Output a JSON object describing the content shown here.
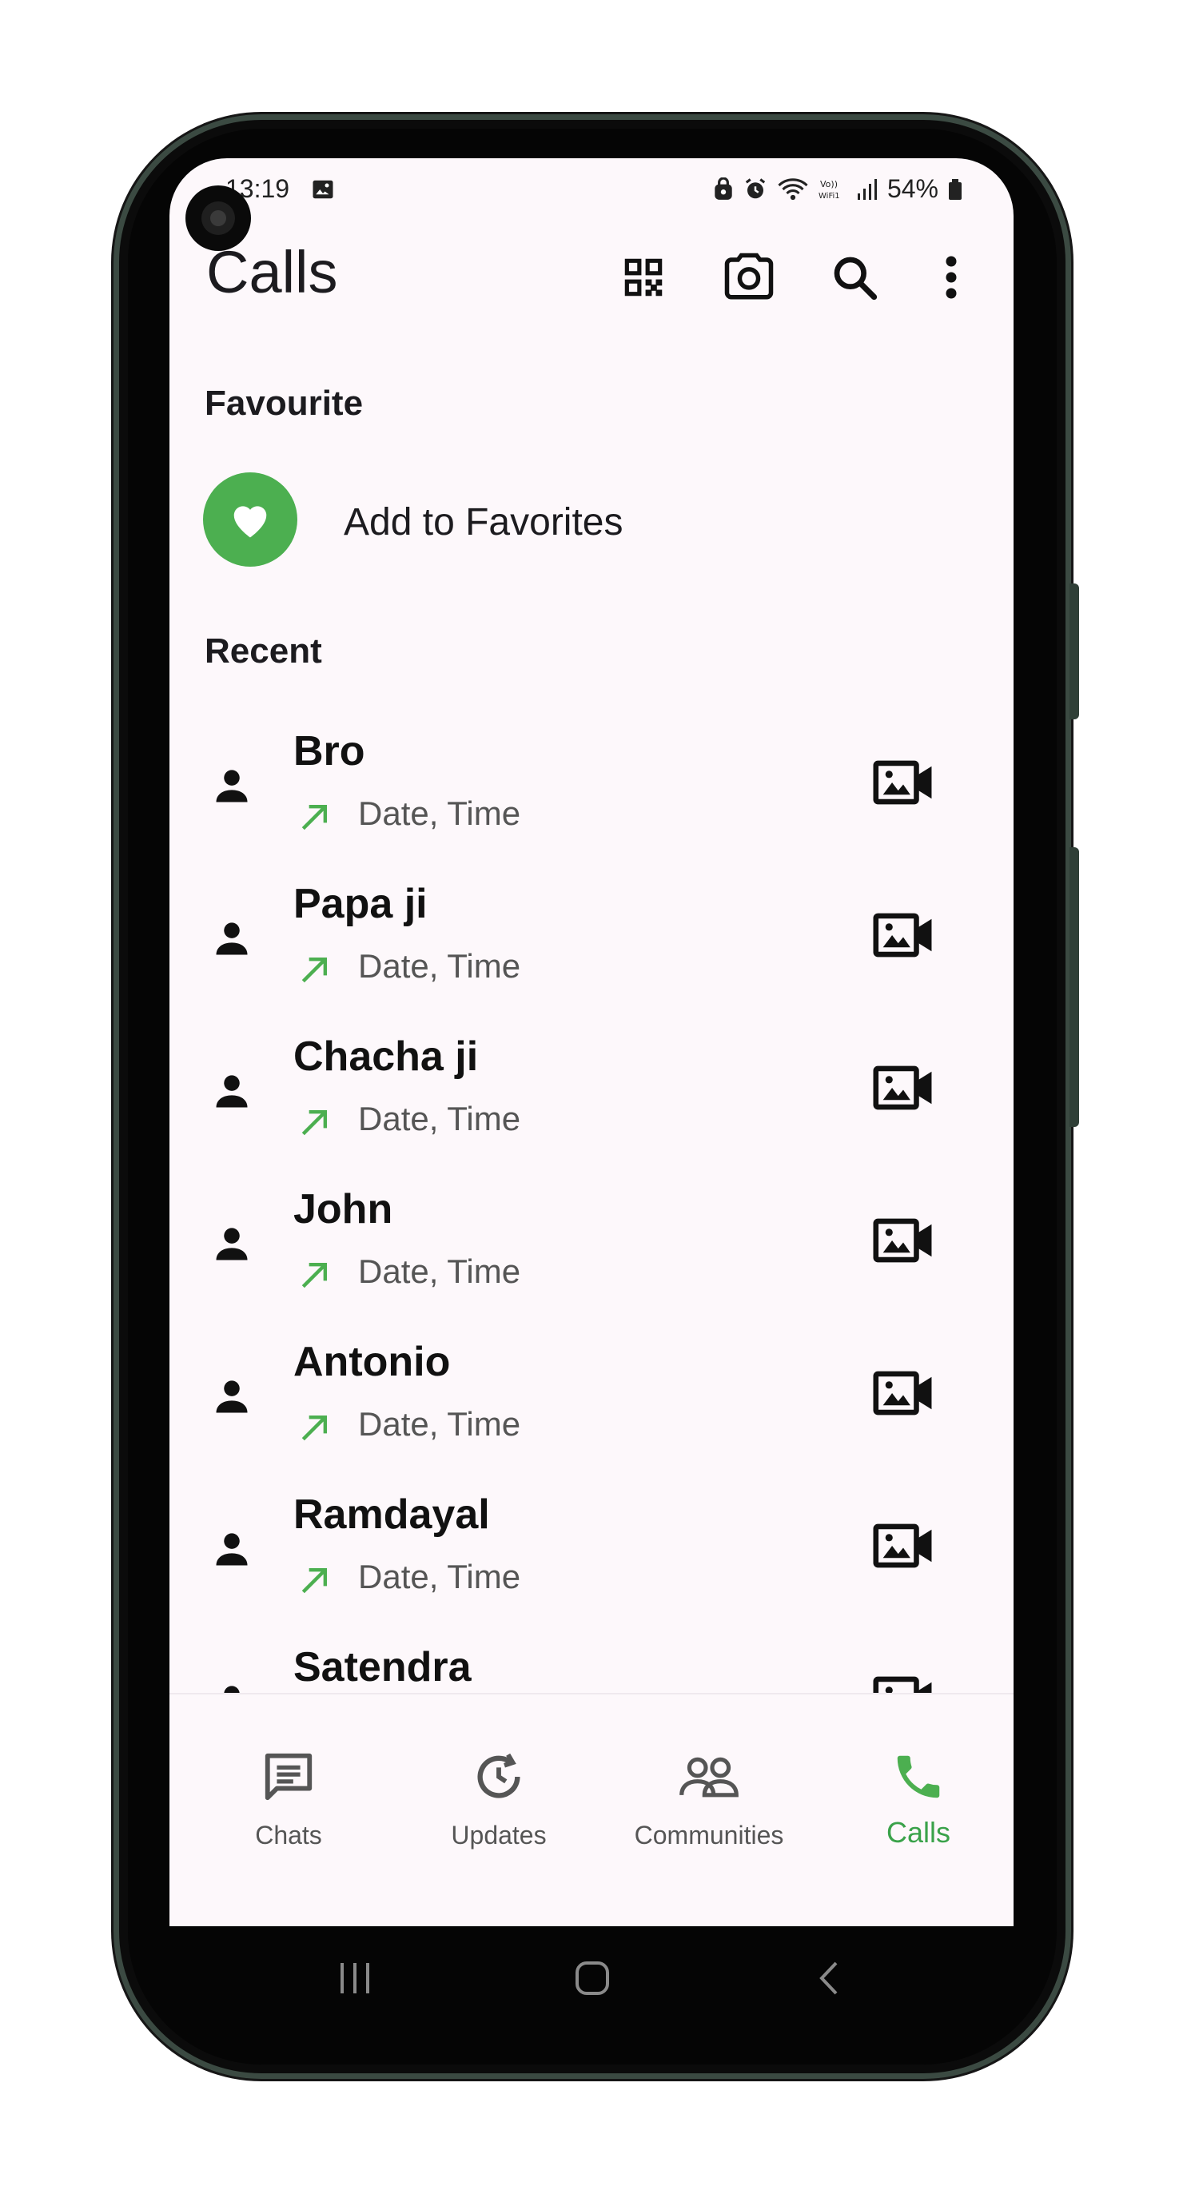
{
  "status_bar": {
    "time": "13:19",
    "battery": "54%"
  },
  "header": {
    "title": "Calls"
  },
  "favourite": {
    "section_title": "Favourite",
    "add_label": "Add to Favorites"
  },
  "recent": {
    "section_title": "Recent",
    "calls": [
      {
        "name": "Bro",
        "detail": "Date, Time"
      },
      {
        "name": "Papa ji",
        "detail": "Date, Time"
      },
      {
        "name": "Chacha ji",
        "detail": "Date, Time"
      },
      {
        "name": "John",
        "detail": "Date, Time"
      },
      {
        "name": "Antonio",
        "detail": "Date, Time"
      },
      {
        "name": "Ramdayal",
        "detail": "Date, Time"
      },
      {
        "name": "Satendra",
        "detail": ""
      }
    ]
  },
  "bottom_nav": {
    "items": [
      {
        "label": "Chats",
        "icon": "chat-icon"
      },
      {
        "label": "Updates",
        "icon": "updates-icon"
      },
      {
        "label": "Communities",
        "icon": "communities-icon"
      },
      {
        "label": "Calls",
        "icon": "call-icon"
      }
    ],
    "active": "Calls"
  },
  "colors": {
    "accent": "#4caf50",
    "active_nav": "#3aa24a",
    "background": "#fdf8fb"
  }
}
